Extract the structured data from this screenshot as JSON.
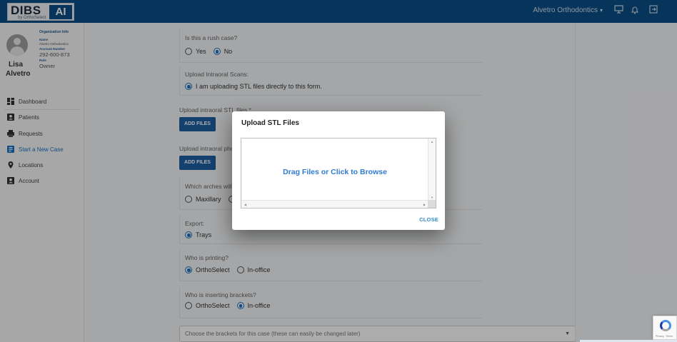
{
  "topbar": {
    "logo_text": "DIBS",
    "logo_ai": "AI",
    "logo_sub": "by OrthoSelect",
    "org_name": "Alvetro Orthodontics",
    "caret": "▾",
    "icons": [
      "monitor-icon",
      "bell-icon",
      "logout-icon"
    ]
  },
  "sidebar": {
    "user_first": "Lisa",
    "user_last": "Alvetro",
    "org_info_label": "Organization Info",
    "name_label": "Name",
    "name_value": "Alvetro Orthodontics",
    "account_label": "Account Number",
    "account_value": "292-600-873",
    "role_label": "Role",
    "role_value": "Owner",
    "nav": [
      {
        "label": "Dashboard",
        "icon": "dashboard-icon"
      },
      {
        "label": "Patients",
        "icon": "patients-icon"
      },
      {
        "label": "Requests",
        "icon": "requests-icon"
      },
      {
        "label": "Start a New Case",
        "icon": "new-case-icon",
        "active": true
      },
      {
        "label": "Locations",
        "icon": "location-icon"
      },
      {
        "label": "Account",
        "icon": "account-icon"
      }
    ]
  },
  "form": {
    "rush_question": "Is this a rush case?",
    "rush_yes": "Yes",
    "rush_no": "No",
    "scans_question": "Upload Intraoral Scans:",
    "scans_option": "I am uploading STL files directly to this form.",
    "stl_label": "Upload intraoral STL files *",
    "add_files_1": "ADD FILES",
    "photos_label": "Upload intraoral photos",
    "add_files_2": "ADD FILES",
    "arches_question": "Which arches will",
    "arches_maxillary": "Maxillary",
    "export_question": "Export:",
    "export_trays": "Trays",
    "printing_question": "Who is printing?",
    "printing_ortho": "OrthoSelect",
    "printing_office": "In-office",
    "brackets_question": "Who is inserting brackets?",
    "brackets_ortho": "OrthoSelect",
    "brackets_office": "In-office",
    "brackets_select": "Choose the brackets for this case (these can easily be changed later)"
  },
  "dialog": {
    "title": "Upload STL Files",
    "dropzone_text": "Drag Files or Click to Browse",
    "close_label": "CLOSE"
  },
  "recaptcha": {
    "text": "Privacy - Terms"
  },
  "colors": {
    "topbar": "#0a4d86",
    "accent": "#1a73c4",
    "button": "#1d5fa0",
    "dropzone_text": "#2f7bd0"
  }
}
